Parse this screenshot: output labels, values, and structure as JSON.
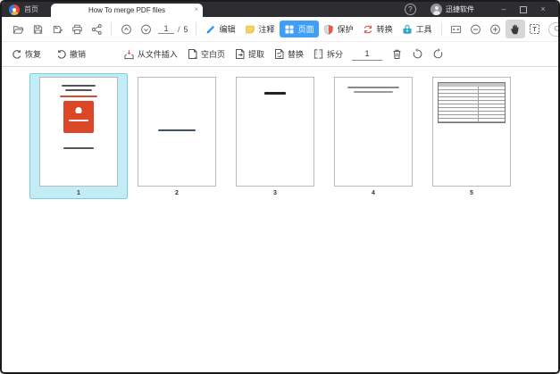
{
  "titlebar": {
    "home_label": "首页",
    "tab_title": "How To merge PDF files",
    "tab_close": "×",
    "help_glyph": "?",
    "account_name": "迅捷软件",
    "minimize_glyph": "–",
    "close_glyph": "×"
  },
  "toolbar": {
    "page_current": "1",
    "page_separator": "/",
    "page_total": "5",
    "modes": [
      {
        "label": "编辑",
        "active": false
      },
      {
        "label": "注释",
        "active": false
      },
      {
        "label": "页面",
        "active": true
      },
      {
        "label": "保护",
        "active": false
      },
      {
        "label": "转换",
        "active": false
      },
      {
        "label": "工具",
        "active": false
      }
    ],
    "search_placeholder": ""
  },
  "actions": {
    "redo_label": "恢复",
    "undo_label": "撤销",
    "insert_from_file_label": "从文件插入",
    "blank_page_label": "空白页",
    "extract_label": "提取",
    "replace_label": "替换",
    "split_label": "拆分",
    "split_page_value": "1"
  },
  "thumbnails": [
    {
      "number": "1",
      "selected": true
    },
    {
      "number": "2",
      "selected": false
    },
    {
      "number": "3",
      "selected": false
    },
    {
      "number": "4",
      "selected": false
    },
    {
      "number": "5",
      "selected": false
    }
  ],
  "colors": {
    "accent_blue": "#3f9ef7",
    "selection_cyan": "#c2ecf6",
    "thumb_logo_red": "#dc4727",
    "titlebar_bg": "#2e2e32"
  }
}
